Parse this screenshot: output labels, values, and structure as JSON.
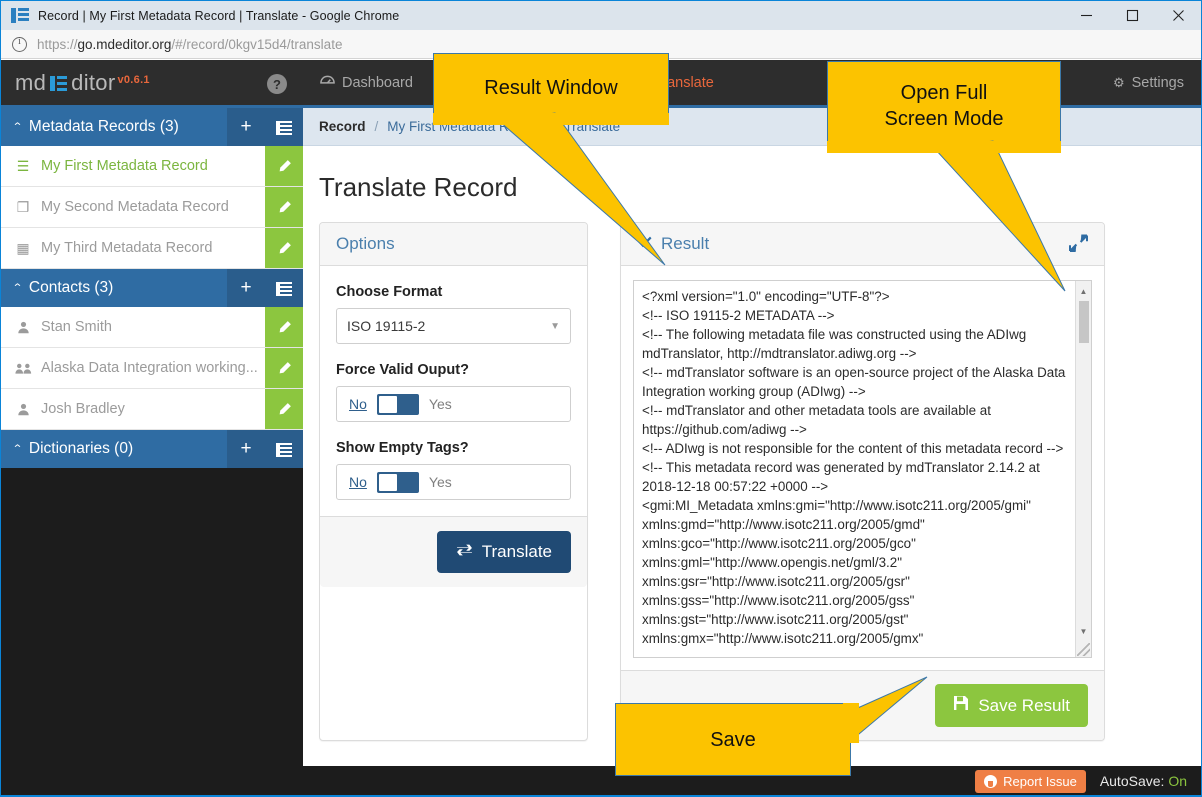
{
  "browser": {
    "tab_icon": "mdeditor-logo-icon",
    "title": "Record | My First Metadata Record | Translate - Google Chrome",
    "minimize_label": "—",
    "maximize_label": "□",
    "close_label": "✕",
    "url_scheme": "https://",
    "url_domain": "go.mdeditor.org",
    "url_path": "/#/record/0kgv15d4/translate",
    "url_full": "https://go.mdeditor.org/#/record/0kgv15d4/translate"
  },
  "brand": {
    "name_left": "md",
    "name_right": "ditor",
    "version": "v0.6.1",
    "help_label": "?"
  },
  "sidebar": {
    "groups": [
      {
        "title": "Metadata Records (3)",
        "caret": "⌃",
        "add_label": "+",
        "list_label": "list",
        "items": [
          {
            "label": "My First Metadata Record",
            "icon": "database-icon",
            "glyph": "☰",
            "active": true,
            "edit_label": "edit"
          },
          {
            "label": "My Second Metadata Record",
            "icon": "copy-icon",
            "glyph": "❐",
            "active": false,
            "edit_label": "edit"
          },
          {
            "label": "My Third Metadata Record",
            "icon": "image-icon",
            "glyph": "▦",
            "active": false,
            "edit_label": "edit"
          }
        ]
      },
      {
        "title": "Contacts (3)",
        "caret": "⌃",
        "add_label": "+",
        "list_label": "list",
        "items": [
          {
            "label": "Stan Smith",
            "icon": "person-icon",
            "glyph": "♟",
            "active": false,
            "edit_label": "edit"
          },
          {
            "label": "Alaska Data Integration working...",
            "icon": "group-icon",
            "glyph": "♟♟",
            "active": false,
            "edit_label": "edit"
          },
          {
            "label": "Josh Bradley",
            "icon": "person-icon",
            "glyph": "♟",
            "active": false,
            "edit_label": "edit"
          }
        ]
      },
      {
        "title": "Dictionaries (0)",
        "caret": "⌃",
        "add_label": "+",
        "list_label": "list",
        "items": []
      }
    ]
  },
  "navbar": {
    "items": [
      {
        "label": "Dashboard",
        "icon": "dashboard-icon",
        "glyph": "☷",
        "active": false
      },
      {
        "label": "Translate",
        "icon": "translate-icon",
        "glyph": "⇄",
        "active": true
      }
    ],
    "settings": {
      "label": "Settings",
      "icon": "gear-icon",
      "glyph": "⚙"
    }
  },
  "breadcrumb": {
    "items": [
      "Record",
      "My First Metadata Record",
      "Translate"
    ],
    "separator": "/"
  },
  "page": {
    "title": "Translate Record"
  },
  "options": {
    "panel_title": "Options",
    "format_label": "Choose Format",
    "format_value": "ISO 19115-2",
    "format_caret": "▼",
    "force_valid_label": "Force Valid Ouput?",
    "force_valid_no": "No",
    "force_valid_yes": "Yes",
    "force_valid_selected": "No",
    "show_empty_label": "Show Empty Tags?",
    "show_empty_no": "No",
    "show_empty_yes": "Yes",
    "show_empty_selected": "No",
    "translate_button": "Translate",
    "translate_icon": "translate-icon"
  },
  "result": {
    "panel_title": "Result",
    "check_icon": "check-icon",
    "expand_icon": "expand-arrows-icon",
    "save_button": "Save Result",
    "save_icon": "floppy-disk-icon",
    "scroll_up": "▲",
    "scroll_down": "▼",
    "xml": "<?xml version=\"1.0\" encoding=\"UTF-8\"?>\n<!-- ISO 19115-2 METADATA -->\n<!-- The following metadata file was constructed using the ADIwg mdTranslator, http://mdtranslator.adiwg.org -->\n<!-- mdTranslator software is an open-source project of the Alaska Data Integration working group (ADIwg) -->\n<!-- mdTranslator and other metadata tools are available at https://github.com/adiwg -->\n<!-- ADIwg is not responsible for the content of this metadata record -->\n<!-- This metadata record was generated by mdTranslator 2.14.2 at 2018-12-18 00:57:22 +0000 -->\n<gmi:MI_Metadata xmlns:gmi=\"http://www.isotc211.org/2005/gmi\" xmlns:gmd=\"http://www.isotc211.org/2005/gmd\" xmlns:gco=\"http://www.isotc211.org/2005/gco\" xmlns:gml=\"http://www.opengis.net/gml/3.2\" xmlns:gsr=\"http://www.isotc211.org/2005/gsr\" xmlns:gss=\"http://www.isotc211.org/2005/gss\" xmlns:gst=\"http://www.isotc211.org/2005/gst\" xmlns:gmx=\"http://www.isotc211.org/2005/gmx\""
  },
  "statusbar": {
    "report_label": "Report Issue",
    "report_icon": "github-icon",
    "autosave_label": "AutoSave:",
    "autosave_value": "On"
  },
  "callouts": {
    "result_window": "Result Window",
    "full_screen": "Open Full\nScreen Mode",
    "full_screen_line1": "Open Full",
    "full_screen_line2": "Screen Mode",
    "save": "Save"
  },
  "colors": {
    "accent_blue": "#2f6ca3",
    "sidebar_dark": "#1c1c1c",
    "green": "#8cc63f",
    "orange": "#e8673c",
    "callout_yellow": "#fcc300",
    "navbar_dark": "#2d2d2d",
    "breadcrumb_bg": "#dde6ef"
  }
}
